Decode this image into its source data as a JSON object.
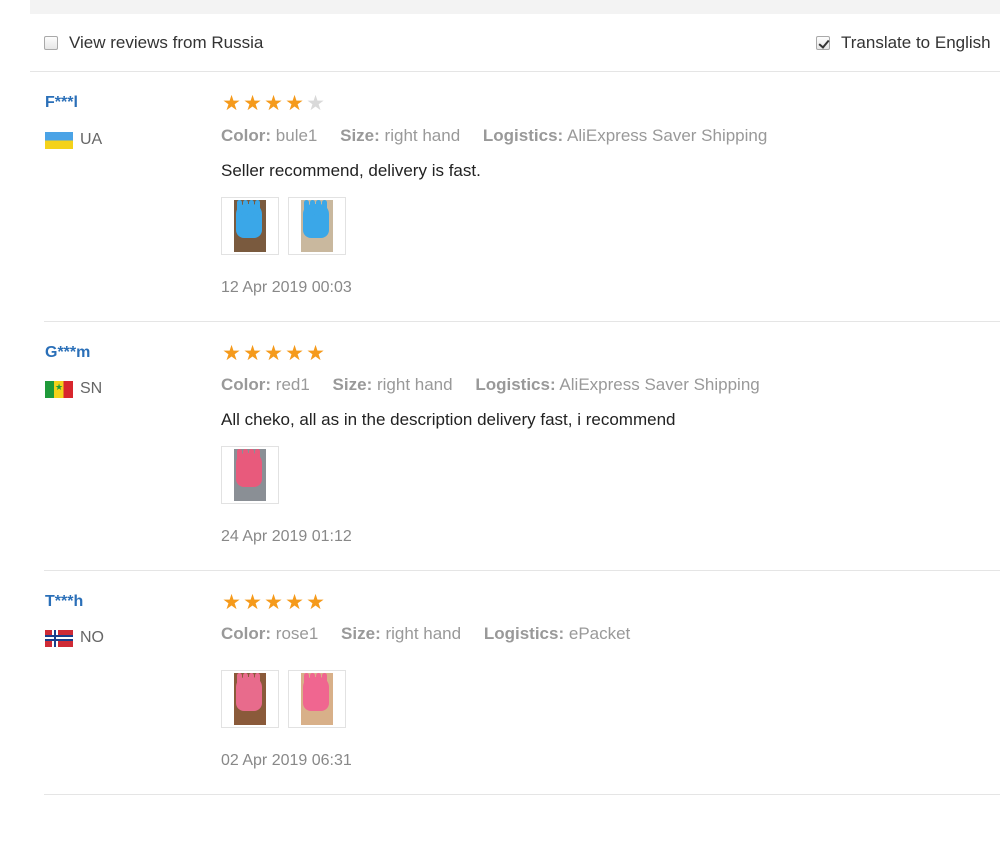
{
  "filters": {
    "russia_label": "View reviews from Russia",
    "russia_checked": false,
    "translate_label": "Translate to English",
    "translate_checked": true
  },
  "colors": {
    "star_on": "#f59a1b",
    "star_off": "#d9d9d9",
    "user_name": "#2a6fb8"
  },
  "reviews": [
    {
      "user": "F***l",
      "country": "UA",
      "flag_icon": "ukraine-flag-icon",
      "rating": 4,
      "color_key": "Color:",
      "color_val": "bule1",
      "size_key": "Size:",
      "size_val": "right hand",
      "logistics_key": "Logistics:",
      "logistics_val": "AliExpress Saver Shipping",
      "text": "Seller recommend, delivery is fast.",
      "photos": [
        {
          "bg": "#7a5a3e",
          "glove": "#3aa7e8"
        },
        {
          "bg": "#c9b89e",
          "glove": "#3aa7e8"
        }
      ],
      "date": "12 Apr 2019 00:03"
    },
    {
      "user": "G***m",
      "country": "SN",
      "flag_icon": "senegal-flag-icon",
      "rating": 5,
      "color_key": "Color:",
      "color_val": "red1",
      "size_key": "Size:",
      "size_val": "right hand",
      "logistics_key": "Logistics:",
      "logistics_val": "AliExpress Saver Shipping",
      "text": "All cheko, all as in the description delivery fast, i recommend",
      "photos": [
        {
          "bg": "#8a8f95",
          "glove": "#e85a7c"
        }
      ],
      "date": "24 Apr 2019 01:12"
    },
    {
      "user": "T***h",
      "country": "NO",
      "flag_icon": "norway-flag-icon",
      "rating": 5,
      "color_key": "Color:",
      "color_val": "rose1",
      "size_key": "Size:",
      "size_val": "right hand",
      "logistics_key": "Logistics:",
      "logistics_val": "ePacket",
      "text": "",
      "photos": [
        {
          "bg": "#8a5a3a",
          "glove": "#e86b8c"
        },
        {
          "bg": "#d8b089",
          "glove": "#f06690"
        }
      ],
      "date": "02 Apr 2019 06:31"
    }
  ]
}
